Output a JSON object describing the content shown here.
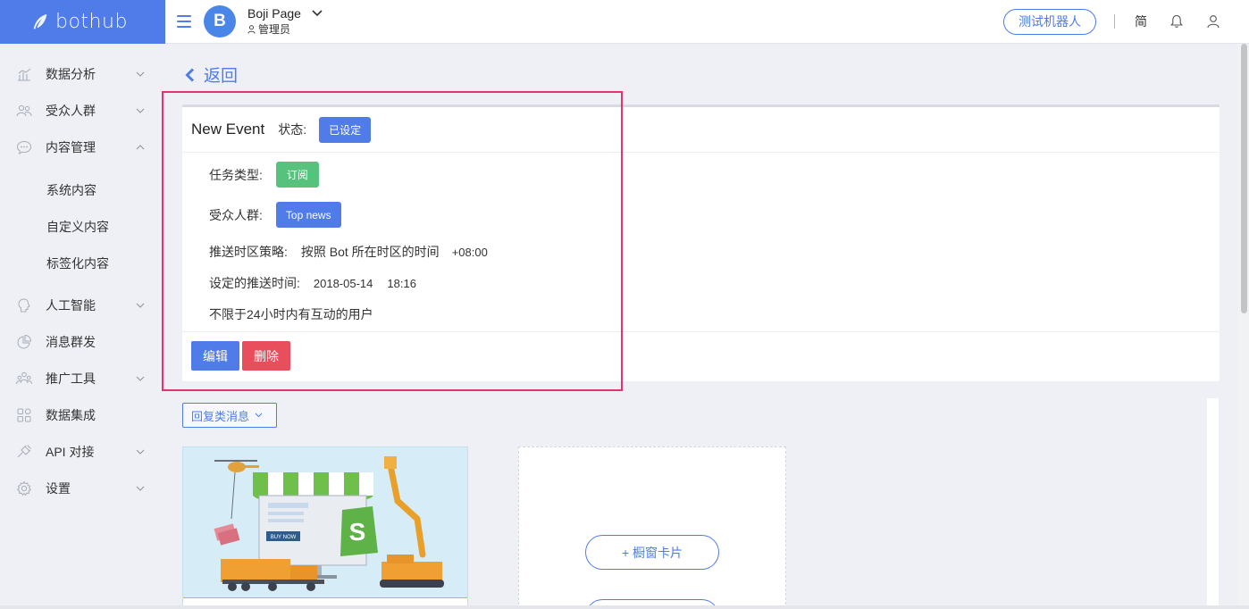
{
  "app": {
    "name": "bothub",
    "brand_color": "#4f7ce9"
  },
  "header": {
    "page_avatar_letter": "B",
    "page_name": "Boji Page",
    "page_role": "管理员",
    "test_bot_label": "测试机器人",
    "language_label": "简"
  },
  "sidebar": {
    "items": [
      {
        "label": "数据分析",
        "icon": "chart-icon"
      },
      {
        "label": "受众人群",
        "icon": "users-icon"
      },
      {
        "label": "内容管理",
        "icon": "chat-bubble-icon"
      },
      {
        "label": "人工智能",
        "icon": "brain-icon"
      },
      {
        "label": "消息群发",
        "icon": "pie-icon"
      },
      {
        "label": "推广工具",
        "icon": "people-group-icon"
      },
      {
        "label": "数据集成",
        "icon": "grid-icon"
      },
      {
        "label": "API 对接",
        "icon": "plug-icon"
      },
      {
        "label": "设置",
        "icon": "gear-icon"
      }
    ],
    "subitems": [
      "系统内容",
      "自定义内容",
      "标签化内容"
    ]
  },
  "main": {
    "back_label": "返回",
    "event": {
      "title": "New Event",
      "status_label": "状态:",
      "status_value": "已设定",
      "task_type_label": "任务类型:",
      "task_type_value": "订阅",
      "audience_label": "受众人群:",
      "audience_value": "Top news",
      "timezone_label": "推送时区策略:",
      "timezone_value": "按照 Bot 所在时区的时间",
      "timezone_offset": "+08:00",
      "schedule_label": "设定的推送时间:",
      "schedule_date": "2018-05-14",
      "schedule_time": "18:16",
      "note": "不限于24小时内有互动的用户",
      "edit_label": "编辑",
      "delete_label": "删除"
    },
    "reply_dropdown_label": "回复类消息",
    "add_carousel_label": "+ 橱窗卡片",
    "image_card_text": "BUY NOW"
  }
}
